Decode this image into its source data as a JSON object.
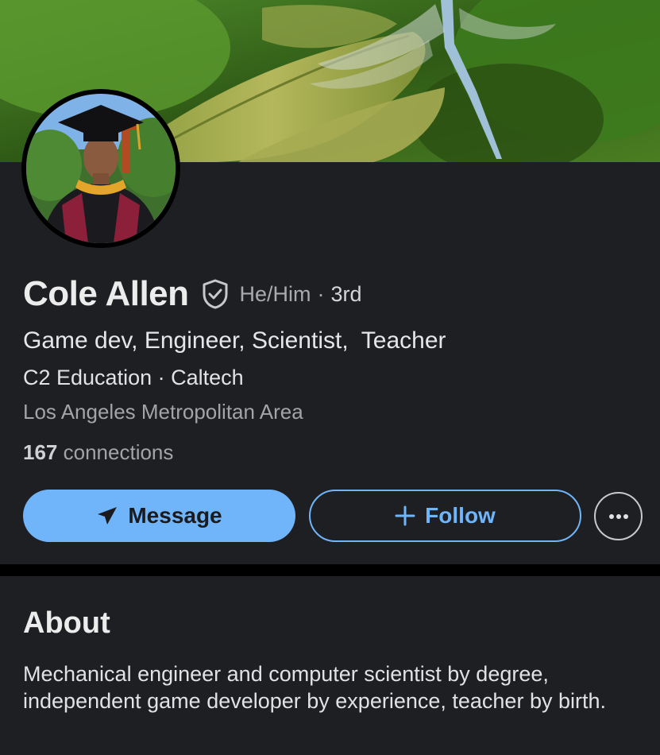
{
  "profile": {
    "name": "Cole Allen",
    "pronouns": "He/Him",
    "separator": "·",
    "degree": "3rd",
    "headline": "Game dev, Engineer, Scientist,  Teacher",
    "org": "C2 Education · Caltech",
    "location": "Los Angeles Metropolitan Area",
    "connections_count": "167",
    "connections_label": "connections"
  },
  "actions": {
    "message_label": "Message",
    "follow_label": "Follow",
    "follow_prefix": "+"
  },
  "about": {
    "title": "About",
    "text": "Mechanical engineer and computer scientist by degree, independent game developer by experience, teacher by birth."
  },
  "icons": {
    "verified": "shield-check-icon",
    "message": "paper-plane-icon",
    "more": "more-horizontal-icon"
  },
  "colors": {
    "accent": "#70b5f9",
    "card_bg": "#1d1f23",
    "page_bg": "#000000"
  }
}
